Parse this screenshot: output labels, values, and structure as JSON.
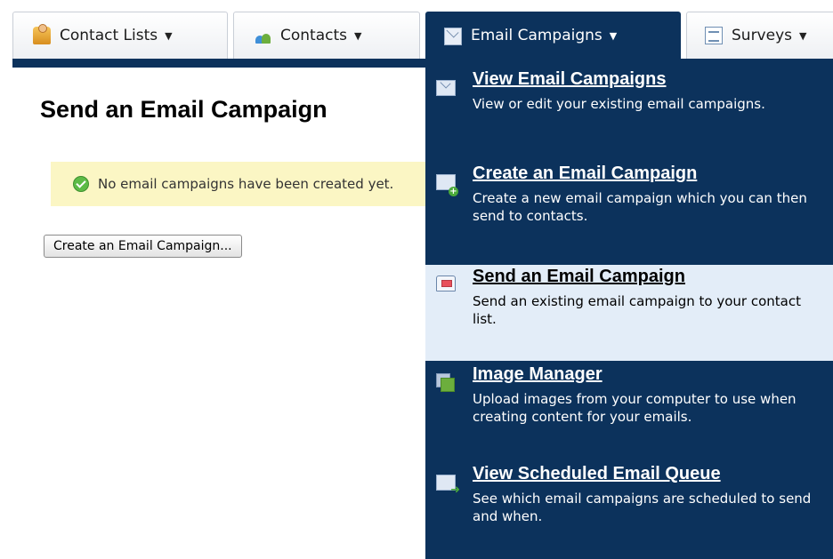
{
  "nav": {
    "tabs": [
      {
        "label": "Contact Lists",
        "icon": "contact-lists-icon"
      },
      {
        "label": "Contacts",
        "icon": "contacts-icon"
      },
      {
        "label": "Email Campaigns",
        "icon": "envelope-icon",
        "active": true
      },
      {
        "label": "Surveys",
        "icon": "survey-icon"
      }
    ],
    "caret": "▼"
  },
  "main": {
    "title": "Send an Email Campaign",
    "notice": "No email campaigns have been created yet.",
    "create_button": "Create an Email Campaign..."
  },
  "dropdown": {
    "items": [
      {
        "title": "View Email Campaigns",
        "desc": "View or edit your existing email campaigns.",
        "icon": "envelope-icon"
      },
      {
        "title": "Create an Email Campaign",
        "desc": "Create a new email campaign which you can then send to contacts.",
        "icon": "envelope-add-icon"
      },
      {
        "title": "Send an Email Campaign",
        "desc": "Send an existing email campaign to your contact list.",
        "icon": "open-envelope-icon",
        "highlighted": true
      },
      {
        "title": "Image Manager",
        "desc": "Upload images from your computer to use when creating content for your emails.",
        "icon": "images-icon"
      },
      {
        "title": "View Scheduled Email Queue",
        "desc": "See which email campaigns are scheduled to send and when.",
        "icon": "envelope-forward-icon"
      }
    ]
  },
  "colors": {
    "nav_dark": "#0c325c",
    "notice_bg": "#fbf6c4",
    "highlight_bg": "#e3edf8"
  }
}
